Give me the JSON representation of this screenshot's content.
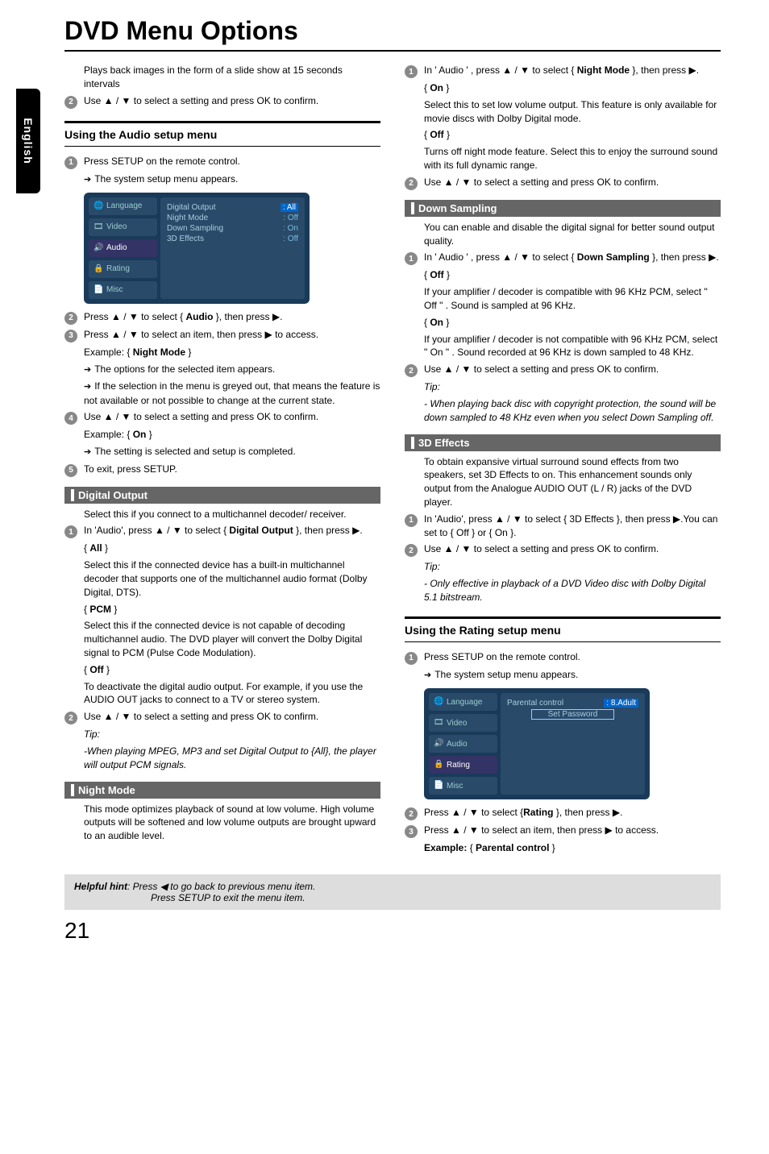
{
  "sideTab": "English",
  "title": "DVD Menu Options",
  "col1": {
    "intro1": "Plays back images in the form of a slide show at 15 seconds intervals",
    "intro2": "Use ▲ / ▼ to select a setting and press OK to confirm.",
    "section1": "Using the Audio setup menu",
    "s1_1": "Press SETUP on the remote control.",
    "s1_1a": "The system setup menu appears.",
    "menu1": {
      "tabs": [
        "Language",
        "Video",
        "Audio",
        "Rating",
        "Misc"
      ],
      "rows": [
        {
          "k": "Digital Output",
          "v": ": All",
          "hl": true
        },
        {
          "k": "Night  Mode",
          "v": ": Off"
        },
        {
          "k": "Down Sampling",
          "v": ": On"
        },
        {
          "k": "3D Effects",
          "v": ": Off"
        }
      ]
    },
    "s1_2": "Press ▲ / ▼ to select { Audio }, then press ▶.",
    "s1_2_bold": "Audio",
    "s1_3": "Press ▲ / ▼ to select an item, then press ▶ to access.",
    "ex1": "Example: { Night Mode }",
    "ex1_bold": "Night Mode",
    "opt1": "The options for the selected item appears.",
    "opt2": "If the selection in the menu is greyed out, that means the feature is not available or not possible to change at the current state.",
    "s1_4": "Use ▲ / ▼ to select a setting and press OK to confirm.",
    "ex2": "Example: { On }",
    "ex2_bold": "On",
    "set1": "The setting is selected and setup is completed.",
    "s1_5": "To exit, press SETUP.",
    "subDigital": "Digital Output",
    "dig1": "Select this if you connect to a multichannel decoder/ receiver.",
    "dig_s1": "In 'Audio', press ▲ / ▼ to select { Digital Output }, then press ▶.",
    "dig_bold": "Digital Output",
    "opt_all": "{ All }",
    "opt_all_b": "All",
    "opt_all_t": "Select this if the connected device has a built-in multichannel decoder that supports one of the multichannel audio format (Dolby Digital, DTS).",
    "opt_pcm": "{ PCM }",
    "opt_pcm_b": "PCM",
    "opt_pcm_t": "Select this if the connected device is not capable of decoding multichannel audio. The DVD player will convert the Dolby Digital signal to PCM (Pulse Code Modulation).",
    "opt_off": "{ Off }",
    "opt_off_b": "Off",
    "opt_off_t": "To deactivate the digital audio output. For example, if you use the AUDIO OUT jacks to connect to a TV or stereo system.",
    "dig_s2": "Use ▲ / ▼ to select a setting  and press OK to confirm.",
    "tip": "Tip:",
    "tip_t": "-When playing MPEG, MP3 and set Digital Output to {All}, the player will output PCM signals.",
    "subNight": "Night Mode",
    "night_t": "This mode optimizes playback of sound at low volume. High volume outputs will be softened and low volume outputs are brought upward to an audible level."
  },
  "col2": {
    "nm_s1": "In ' Audio ' , press ▲ / ▼ to select { Night Mode }, then press ▶.",
    "nm_bold": "Night Mode",
    "nm_on": "{ On }",
    "nm_on_b": "On",
    "nm_on_t": "Select this to set low volume output. This feature is only available for movie discs with Dolby Digital mode.",
    "nm_off": "{ Off }",
    "nm_off_b": "Off",
    "nm_off_t": "Turns off night mode feature. Select this to enjoy the surround sound with its full dynamic range.",
    "nm_s2": "Use ▲ / ▼ to select a setting and press OK to confirm.",
    "subDown": "Down Sampling",
    "ds_intro": "You can enable and disable the digital signal for better sound output quality.",
    "ds_s1": "In ' Audio ' , press ▲ / ▼ to select { Down Sampling }, then press ▶.",
    "ds_bold": "Down Sampling",
    "ds_off": "{ Off }",
    "ds_off_b": "Off",
    "ds_off_t": "If your amplifier / decoder is compatible with 96 KHz PCM, select \" Off \" . Sound is sampled at 96 KHz.",
    "ds_on": "{ On }",
    "ds_on_b": "On",
    "ds_on_t": "If your amplifier / decoder is not compatible with 96 KHz PCM, select \" On \" . Sound recorded at 96 KHz is down sampled to 48 KHz.",
    "ds_s2": "Use ▲ / ▼ to select a setting and press OK to confirm.",
    "tip2": "Tip:",
    "tip2_t": "- When playing back disc with copyright protection, the sound will be down sampled to 48 KHz even when you select Down Sampling off.",
    "sub3d": "3D Effects",
    "td_intro": "To obtain expansive virtual surround sound effects from two speakers, set 3D Effects to on. This enhancement sounds only output from the Analogue AUDIO OUT (L / R) jacks of the DVD player.",
    "td_s1": "In 'Audio', press ▲ / ▼ to select { 3D Effects }, then press ▶.You can set to { Off } or { On }.",
    "td_s2": "Use ▲ / ▼ to select a setting and press OK to confirm.",
    "tip3": "Tip:",
    "tip3_t": "- Only effective in playback of a DVD Video disc with Dolby Digital 5.1 bitstream.",
    "section2": "Using the Rating setup menu",
    "r_s1": "Press SETUP on the remote control.",
    "r_s1a": "The system setup menu appears.",
    "menu2": {
      "tabs": [
        "Language",
        "Video",
        "Audio",
        "Rating",
        "Misc"
      ],
      "rows": [
        {
          "k": "Parental  control",
          "v": ": 8.Adult",
          "hl": true
        },
        {
          "k": "Set Password",
          "v": ""
        }
      ]
    },
    "r_s2": "Press ▲ / ▼ to select {Rating }, then press ▶.",
    "r_s2_bold": "Rating",
    "r_s3": "Press ▲ / ▼ to select an item, then press ▶ to access.",
    "r_ex": "Example: { Parental control }",
    "r_ex_b": "Example:",
    "r_ex_b2": "Parental control"
  },
  "footer1": "Helpful hint",
  "footer2": ":  Press ◀ to go back to previous menu item.",
  "footer3": "Press SETUP to exit the menu item.",
  "pageNum": "21"
}
